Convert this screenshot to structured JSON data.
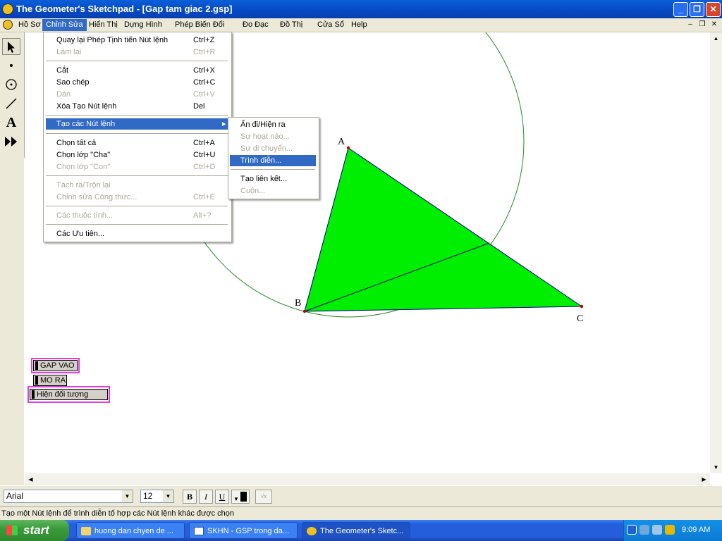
{
  "window": {
    "title": "The Geometer's Sketchpad - [Gap tam giac 2.gsp]"
  },
  "menubar": {
    "items": [
      "Hồ Sơ",
      "Chỉnh Sửa",
      "Hiển Thị",
      "Dựng Hình",
      "Phép Biến Đổi",
      "Đo Đạc",
      "Đồ Thị",
      "Cửa Sổ",
      "Help"
    ]
  },
  "edit_menu": {
    "items": [
      {
        "label": "Quay lại Phép Tịnh tiến Nút lệnh",
        "shortcut": "Ctrl+Z",
        "enabled": true
      },
      {
        "label": "Làm lại",
        "shortcut": "Ctrl+R",
        "enabled": false
      },
      {
        "label": "Cắt",
        "shortcut": "Ctrl+X",
        "enabled": true
      },
      {
        "label": "Sao chép",
        "shortcut": "Ctrl+C",
        "enabled": true
      },
      {
        "label": "Dán",
        "shortcut": "Ctrl+V",
        "enabled": false
      },
      {
        "label": "Xóa Tạo Nút lệnh",
        "shortcut": "Del",
        "enabled": true
      },
      {
        "label": "Tạo các Nút lệnh",
        "shortcut": "",
        "enabled": true
      },
      {
        "label": "Chọn tất cả",
        "shortcut": "Ctrl+A",
        "enabled": true
      },
      {
        "label": "Chọn lớp \"Cha\"",
        "shortcut": "Ctrl+U",
        "enabled": true
      },
      {
        "label": "Chọn lớp \"Con\"",
        "shortcut": "Ctrl+D",
        "enabled": false
      },
      {
        "label": "Tách ra/Trộn lại",
        "shortcut": "",
        "enabled": false
      },
      {
        "label": "Chỉnh sửa Công thức...",
        "shortcut": "Ctrl+E",
        "enabled": false
      },
      {
        "label": "Các thuộc tính...",
        "shortcut": "Alt+?",
        "enabled": false
      },
      {
        "label": "Các Ưu tiên...",
        "shortcut": "",
        "enabled": true
      }
    ]
  },
  "submenu": {
    "items": [
      {
        "label": "Ẩn đi/Hiện ra",
        "enabled": true
      },
      {
        "label": "Sự hoạt náo...",
        "enabled": false
      },
      {
        "label": "Sự di chuyển...",
        "enabled": false
      },
      {
        "label": "Trình diễn...",
        "enabled": true,
        "highlighted": true
      },
      {
        "label": "Tạo liên kết...",
        "enabled": true
      },
      {
        "label": "Cuộn...",
        "enabled": false
      }
    ]
  },
  "sketch": {
    "points": {
      "a": "A",
      "b": "B",
      "c": "C"
    },
    "triangle_fill": "#00ee00",
    "circle_color": "#228b22",
    "buttons": [
      "GAP VAO",
      "MO RA",
      "Hiện đối tượng"
    ]
  },
  "text_toolbar": {
    "font": "Arial",
    "size": "12",
    "bold": "B",
    "italic": "I",
    "underline": "U"
  },
  "status": "Tạo một Nút lệnh để trình diễn tố hợp các Nút lệnh khác được chọn",
  "taskbar": {
    "start": "start",
    "tasks": [
      "huong dan chyen de ...",
      "SKHN - GSP trong da...",
      "The Geometer's Sketc..."
    ],
    "clock": "9:09 AM"
  }
}
